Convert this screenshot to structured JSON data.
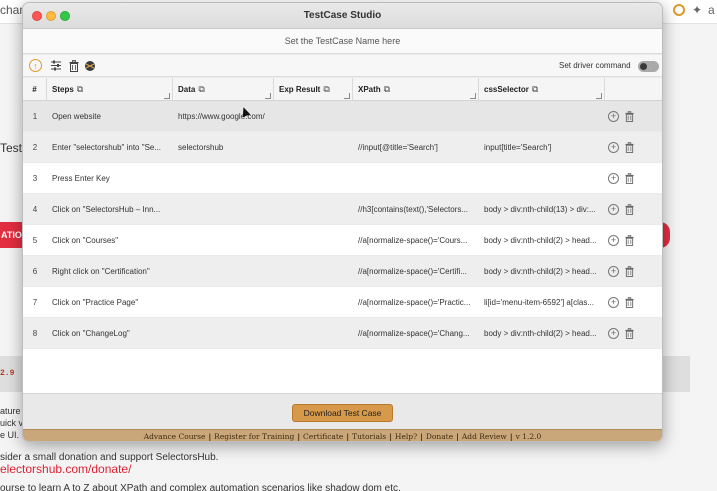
{
  "background": {
    "url_fragment": "changelog/",
    "side_text_1": "Test",
    "red_left_text": "ATIO",
    "band_text": "2.9",
    "left_frag_1": "ature",
    "left_frag_2": "uick v",
    "left_frag_3": "e UI.",
    "bottom_line_1": "sider a small donation and support SelectorsHub.",
    "bottom_link": "electorshub.com/donate/",
    "bottom_line_3": "ourse to learn A to Z about XPath and complex automation scenarios like shadow dom etc."
  },
  "window": {
    "title": "TestCase Studio",
    "testcase_name_placeholder": "Set the TestCase Name here"
  },
  "toolbar": {
    "driver_command_label": "Set driver command",
    "driver_command_enabled": false
  },
  "table": {
    "headers": {
      "num": "#",
      "steps": "Steps",
      "data": "Data",
      "exp_result": "Exp Result",
      "xpath": "XPath",
      "css_selector": "cssSelector"
    },
    "rows": [
      {
        "num": "1",
        "step": "Open website",
        "data": "https://www.google.com/",
        "exp": "",
        "xpath": "",
        "css": ""
      },
      {
        "num": "2",
        "step": "Enter \"selectorshub\" into \"Se...",
        "data": "selectorshub",
        "exp": "",
        "xpath": "//input[@title='Search']",
        "css": "input[title='Search']"
      },
      {
        "num": "3",
        "step": "Press Enter Key",
        "data": "",
        "exp": "",
        "xpath": "",
        "css": ""
      },
      {
        "num": "4",
        "step": "Click on \"SelectorsHub – Inn...",
        "data": "",
        "exp": "",
        "xpath": "//h3[contains(text(),'Selectors...",
        "css": "body > div:nth-child(13) > div:..."
      },
      {
        "num": "5",
        "step": "Click on \"Courses\"",
        "data": "",
        "exp": "",
        "xpath": "//a[normalize-space()='Cours...",
        "css": "body > div:nth-child(2) > head..."
      },
      {
        "num": "6",
        "step": "Right click on \"Certification\"",
        "data": "",
        "exp": "",
        "xpath": "//a[normalize-space()='Certifi...",
        "css": "body > div:nth-child(2) > head..."
      },
      {
        "num": "7",
        "step": "Click on \"Practice Page\"",
        "data": "",
        "exp": "",
        "xpath": "//a[normalize-space()='Practic...",
        "css": "li[id='menu-item-6592'] a[clas..."
      },
      {
        "num": "8",
        "step": "Click on \"ChangeLog\"",
        "data": "",
        "exp": "",
        "xpath": "//a[normalize-space()='Chang...",
        "css": "body > div:nth-child(2) > head..."
      }
    ]
  },
  "footer": {
    "download_label": "Download Test Case",
    "links": [
      "Advance Course",
      "Register for Training",
      "Certificate",
      "Tutorials",
      "Help?",
      "Donate",
      "Add Review"
    ],
    "version": "v 1.2.0"
  },
  "colors": {
    "accent_orange": "#d79a4a",
    "link_bar": "#c9a77a",
    "traffic_close": "#fc5753",
    "traffic_min": "#fdbc40",
    "traffic_max": "#34c84a",
    "promo_red": "#e32d41"
  },
  "icons": {
    "toolbar": [
      "record-icon",
      "sliders-icon",
      "trash-icon",
      "bug-icon"
    ],
    "row_actions": [
      "add-step-icon",
      "delete-step-icon"
    ],
    "header_copy": "copy-icon"
  }
}
